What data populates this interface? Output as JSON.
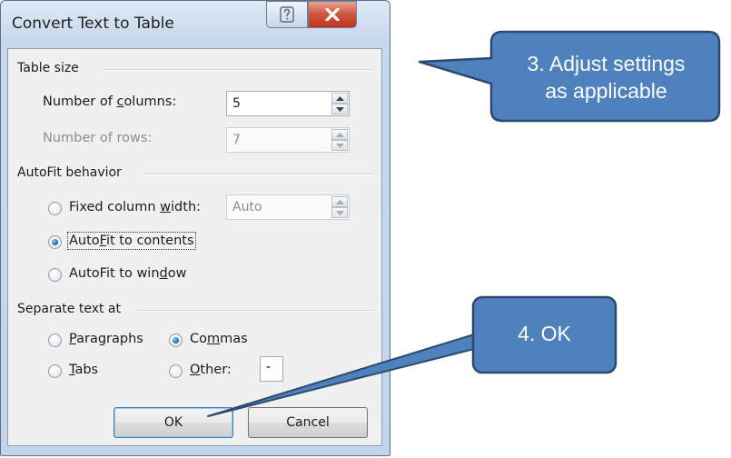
{
  "dialog": {
    "title": "Convert Text to Table",
    "help_icon": "question-mark-icon",
    "close_icon": "close-x-icon"
  },
  "table_size": {
    "header": "Table size",
    "columns_label_pre": "Number of ",
    "columns_label_key": "c",
    "columns_label_post": "olumns:",
    "columns_value": "5",
    "rows_label": "Number of rows:",
    "rows_value": "7"
  },
  "autofit": {
    "header": "AutoFit behavior",
    "fixed_pre": "Fixed column ",
    "fixed_key": "w",
    "fixed_post": "idth:",
    "fixed_value": "Auto",
    "contents_pre": "Auto",
    "contents_key": "F",
    "contents_post": "it to contents",
    "window_pre": "AutoFit to win",
    "window_key": "d",
    "window_post": "ow",
    "selected": "AutoFit to contents"
  },
  "separate": {
    "header": "Separate text at",
    "paragraphs_key": "P",
    "paragraphs_post": "aragraphs",
    "commas_pre": "Co",
    "commas_key": "m",
    "commas_post": "mas",
    "tabs_key": "T",
    "tabs_post": "abs",
    "other_key": "O",
    "other_post": "ther:",
    "other_value": "-",
    "selected": "Commas"
  },
  "buttons": {
    "ok": "OK",
    "cancel": "Cancel"
  },
  "callouts": {
    "adjust_line1": "3. Adjust settings",
    "adjust_line2": "as applicable",
    "ok": "4. OK",
    "fill_color": "#4f81bd",
    "border_color": "#2c4a70"
  }
}
